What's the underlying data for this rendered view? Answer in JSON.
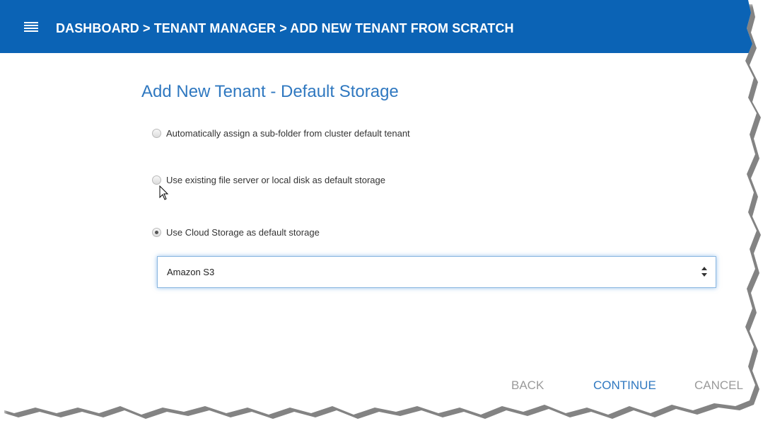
{
  "header": {
    "breadcrumb": "DASHBOARD > TENANT MANAGER > ADD NEW TENANT FROM SCRATCH",
    "menu_icon": "hamburger-menu-icon",
    "background_color": "#0b63b5"
  },
  "main": {
    "title": "Add New Tenant - Default Storage",
    "options": [
      {
        "label": "Automatically assign a sub-folder from cluster default tenant",
        "checked": false
      },
      {
        "label": "Use existing file server or local disk as default storage",
        "checked": false
      },
      {
        "label": "Use Cloud Storage as default storage",
        "checked": true
      }
    ],
    "storage_select": {
      "value": "Amazon S3",
      "icon": "sort-arrows-icon"
    }
  },
  "footer": {
    "back_label": "BACK",
    "continue_label": "CONTINUE",
    "cancel_label": "CANCEL"
  },
  "colors": {
    "accent": "#2f78c0",
    "disabled": "#9a9a9a"
  }
}
